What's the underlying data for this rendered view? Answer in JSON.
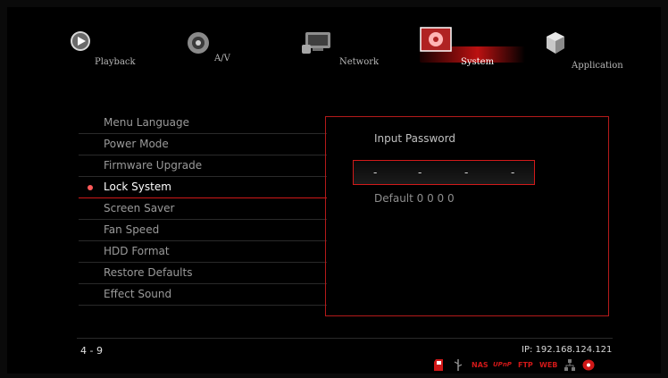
{
  "categories": [
    {
      "label": "Playback",
      "icon": "playback-icon"
    },
    {
      "label": "A/V",
      "icon": "av-icon"
    },
    {
      "label": "Network",
      "icon": "network-icon"
    },
    {
      "label": "System",
      "icon": "system-icon",
      "selected": true
    },
    {
      "label": "Application",
      "icon": "application-icon"
    }
  ],
  "menu": {
    "items": [
      {
        "label": "Menu Language"
      },
      {
        "label": "Power Mode"
      },
      {
        "label": "Firmware Upgrade"
      },
      {
        "label": "Lock System",
        "active": true
      },
      {
        "label": "Screen Saver"
      },
      {
        "label": "Fan Speed"
      },
      {
        "label": "HDD Format"
      },
      {
        "label": "Restore Defaults"
      },
      {
        "label": "Effect Sound"
      }
    ]
  },
  "panel": {
    "title": "Input Password",
    "password_slots": [
      "-",
      "-",
      "-",
      "-"
    ],
    "hint": "Default 0 0 0 0"
  },
  "footer": {
    "page": "4 - 9",
    "ip": "IP: 192.168.124.121",
    "status_icons": {
      "nas": "NAS",
      "upnp": "UPnP",
      "ftp": "FTP",
      "web": "WEB"
    }
  },
  "colors": {
    "accent": "#d01818",
    "background": "#000000",
    "menu_text": "#9a9a9a",
    "active_text": "#ffffff"
  }
}
